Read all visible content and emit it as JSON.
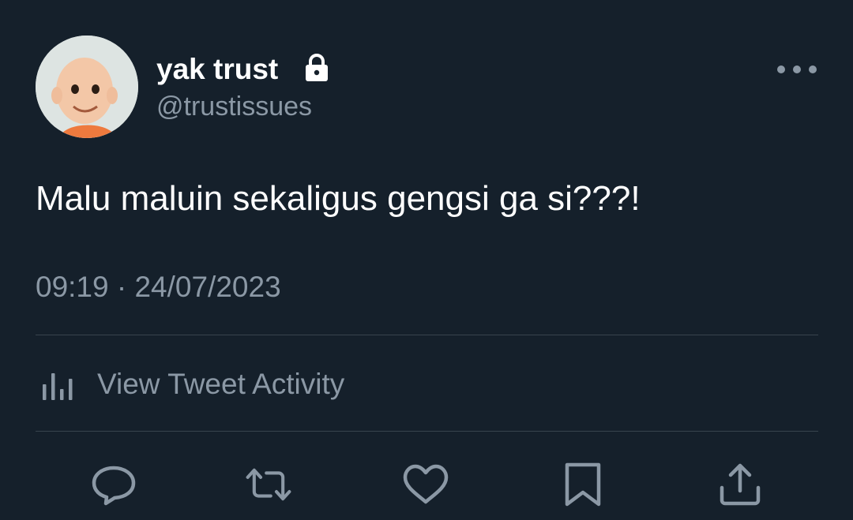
{
  "author": {
    "display_name": "yak trust",
    "handle": "@trustissues",
    "avatar_icon": "avatar-image",
    "protected_icon": "lock-icon"
  },
  "tweet": {
    "text": "Malu maluin sekaligus gengsi ga si???!",
    "timestamp": "09:19 · 24/07/2023"
  },
  "activity": {
    "icon": "bar-chart-icon",
    "label": "View Tweet Activity"
  },
  "actions": [
    {
      "name": "reply",
      "icon": "reply-icon"
    },
    {
      "name": "retweet",
      "icon": "retweet-icon"
    },
    {
      "name": "like",
      "icon": "heart-icon"
    },
    {
      "name": "bookmark",
      "icon": "bookmark-icon"
    },
    {
      "name": "share",
      "icon": "share-icon"
    }
  ],
  "menu_icon": "more-options-icon",
  "colors": {
    "background": "#15202b",
    "primary_text": "#ffffff",
    "secondary_text": "#8b98a5",
    "divider": "#38444d"
  }
}
